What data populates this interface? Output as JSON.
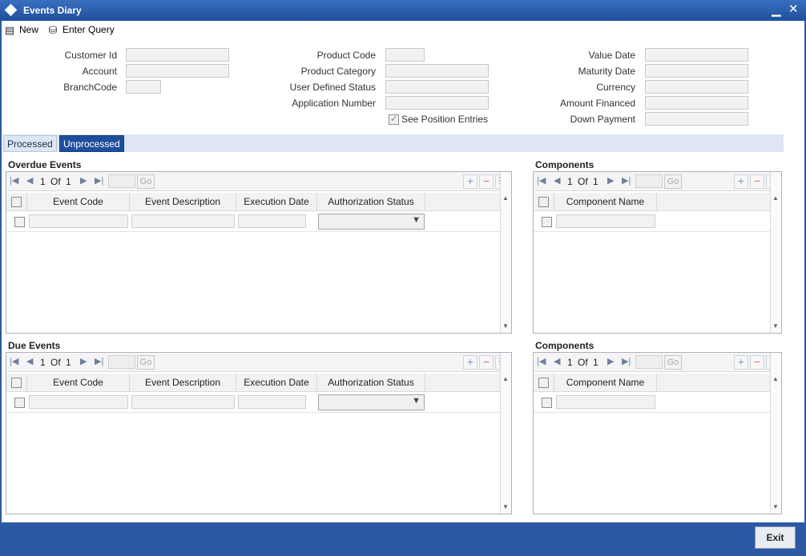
{
  "window": {
    "title": "Events Diary"
  },
  "toolbar": {
    "new_label": "New",
    "enter_query_label": "Enter Query"
  },
  "header": {
    "customer_id_label": "Customer Id",
    "account_label": "Account",
    "branch_code_label": "BranchCode",
    "product_code_label": "Product Code",
    "product_category_label": "Product Category",
    "user_defined_status_label": "User Defined Status",
    "application_number_label": "Application Number",
    "see_position_entries_label": "See Position Entries",
    "value_date_label": "Value Date",
    "maturity_date_label": "Maturity Date",
    "currency_label": "Currency",
    "amount_financed_label": "Amount Financed",
    "down_payment_label": "Down Payment"
  },
  "tabs": {
    "processed": "Processed",
    "unprocessed": "Unprocessed"
  },
  "overdue": {
    "title": "Overdue Events",
    "pagination": {
      "current": "1",
      "of": "Of",
      "total": "1",
      "go": "Go"
    },
    "columns": [
      "Event Code",
      "Event Description",
      "Execution Date",
      "Authorization Status"
    ]
  },
  "overdue_components": {
    "title": "Components",
    "pagination": {
      "current": "1",
      "of": "Of",
      "total": "1",
      "go": "Go"
    },
    "columns": [
      "Component Name"
    ]
  },
  "due": {
    "title": "Due Events",
    "pagination": {
      "current": "1",
      "of": "Of",
      "total": "1",
      "go": "Go"
    },
    "columns": [
      "Event Code",
      "Event Description",
      "Execution Date",
      "Authorization Status"
    ]
  },
  "due_components": {
    "title": "Components",
    "pagination": {
      "current": "1",
      "of": "Of",
      "total": "1",
      "go": "Go"
    },
    "columns": [
      "Component Name"
    ]
  },
  "footer": {
    "exit_label": "Exit"
  }
}
